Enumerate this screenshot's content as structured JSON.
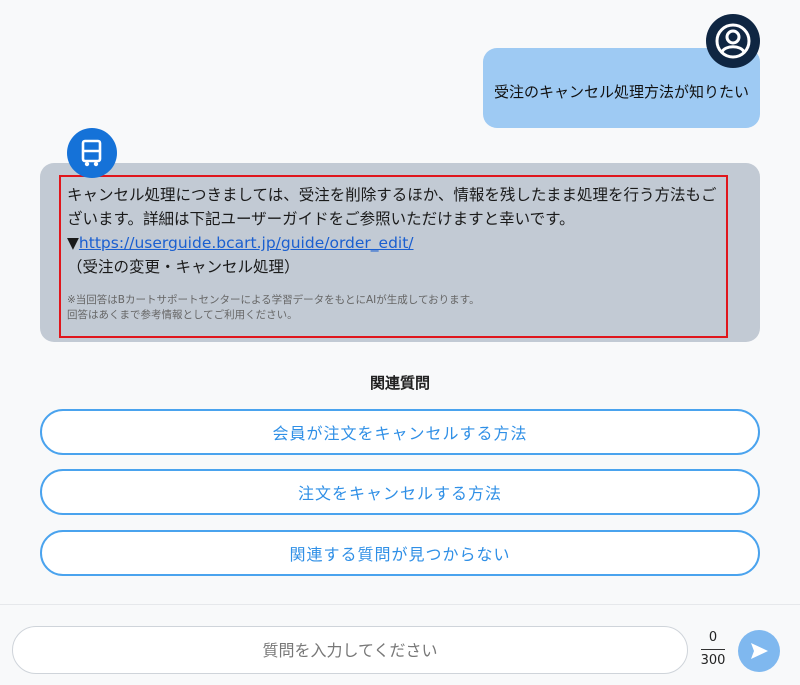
{
  "user_message": {
    "text": "受注のキャンセル処理方法が知りたい",
    "avatar_icon": "user-icon"
  },
  "bot_message": {
    "avatar_icon": "bot-logo-icon",
    "line1": "キャンセル処理につきましては、受注を削除するほか、情報を残したまま処理を行う方法もございます。詳細は下記ユーザーガイドをご参照いただけますと幸いです。",
    "link_prefix": "▼",
    "link_text": "https://userguide.bcart.jp/guide/order_edit/",
    "link_caption": "（受注の変更・キャンセル処理）",
    "note_line1": "※当回答はBカートサポートセンターによる学習データをもとにAIが生成しております。",
    "note_line2": "回答はあくまで参考情報としてご利用ください。"
  },
  "related": {
    "heading": "関連質問",
    "questions": [
      "会員が注文をキャンセルする方法",
      "注文をキャンセルする方法",
      "関連する質問が見つからない"
    ]
  },
  "input": {
    "placeholder": "質問を入力してください",
    "value": "",
    "count": "0",
    "max": "300"
  },
  "colors": {
    "user_bubble": "#9ecaf3",
    "bot_bubble": "#c2cad4",
    "highlight_border": "#e0161c",
    "accent": "#2f8fe6",
    "send_button": "#7fb8ef"
  }
}
